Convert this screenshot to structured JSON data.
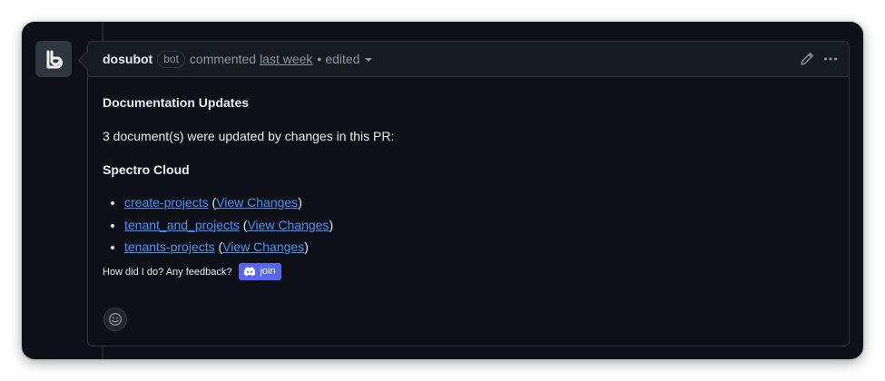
{
  "comment": {
    "author": "dosubot",
    "badge": "bot",
    "action": "commented",
    "time": "last week",
    "separator": "•",
    "edited": "edited"
  },
  "body": {
    "title": "Documentation Updates",
    "summary": "3 document(s) were updated by changes in this PR:",
    "section": "Spectro Cloud",
    "docs": [
      {
        "name": "create-projects",
        "link": "View Changes"
      },
      {
        "name": "tenant_and_projects",
        "link": "View Changes"
      },
      {
        "name": "tenants-projects",
        "link": "View Changes"
      }
    ],
    "feedback": {
      "prompt": "How did I do? Any feedback?",
      "join_label": "join"
    }
  },
  "icons": {
    "avatar": "dosubot-logo-icon",
    "edit": "pencil-icon",
    "more": "kebab-horizontal-icon",
    "dropdown": "triangle-down-icon",
    "discord": "discord-icon",
    "reaction": "smiley-icon"
  },
  "colors": {
    "background": "#0d1117",
    "header": "#161b22",
    "border": "#30363d",
    "text": "#e6edf3",
    "muted": "#8d96a0",
    "link": "#4493f8",
    "discord": "#5865f2"
  }
}
